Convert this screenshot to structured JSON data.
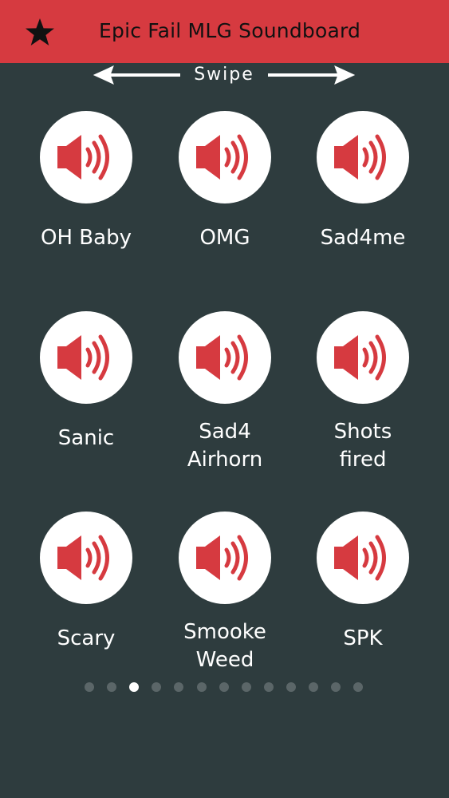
{
  "header": {
    "title": "Epic Fail MLG Soundboard",
    "favorite_icon": "star-icon",
    "background_color": "#d63a40"
  },
  "swipe": {
    "label": "Swipe",
    "left_icon": "arrow-left-icon",
    "right_icon": "arrow-right-icon"
  },
  "sounds": [
    {
      "label": "OH Baby",
      "icon": "speaker-icon"
    },
    {
      "label": "OMG",
      "icon": "speaker-icon"
    },
    {
      "label": "Sad4me",
      "icon": "speaker-icon"
    },
    {
      "label": "Sanic",
      "icon": "speaker-icon"
    },
    {
      "label": "Sad4\nAirhorn",
      "icon": "speaker-icon"
    },
    {
      "label": "Shots\nfired",
      "icon": "speaker-icon"
    },
    {
      "label": "Scary",
      "icon": "speaker-icon"
    },
    {
      "label": "Smooke\nWeed",
      "icon": "speaker-icon"
    },
    {
      "label": "SPK",
      "icon": "speaker-icon"
    }
  ],
  "pagination": {
    "page_count": 13,
    "current_page": 3
  },
  "colors": {
    "background": "#2e3c3e",
    "accent": "#d63a40",
    "text": "#ffffff",
    "dot_inactive": "#5b6668",
    "dot_active": "#ffffff"
  }
}
